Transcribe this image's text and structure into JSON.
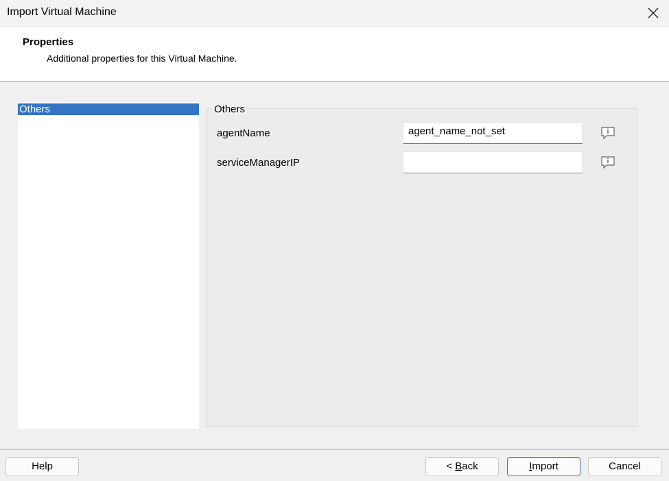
{
  "window": {
    "title": "Import Virtual Machine"
  },
  "header": {
    "title": "Properties",
    "subtitle": "Additional properties for this Virtual Machine."
  },
  "categories": [
    {
      "label": "Others",
      "selected": true
    }
  ],
  "group": {
    "title": "Others",
    "properties": [
      {
        "label": "agentName",
        "value": "agent_name_not_set",
        "icon": "info-comment-icon"
      },
      {
        "label": "serviceManagerIP",
        "value": "",
        "icon": "info-comment-icon"
      }
    ]
  },
  "footer": {
    "help_label": "Help",
    "back_prefix": "< ",
    "back_mnemonic": "B",
    "back_rest": "ack",
    "import_mnemonic": "I",
    "import_rest": "mport",
    "cancel_label": "Cancel"
  },
  "colors": {
    "selection": "#3374c4",
    "primary_button_border": "#3a74c6"
  }
}
